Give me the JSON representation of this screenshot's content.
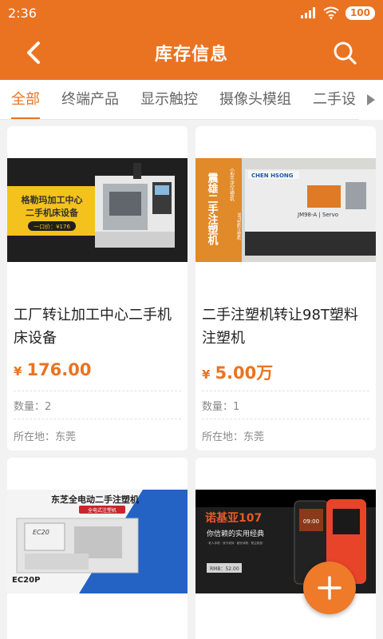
{
  "status": {
    "time": "2:36",
    "battery": "100"
  },
  "header": {
    "title": "库存信息"
  },
  "tabs": [
    "全部",
    "终端产品",
    "显示触控",
    "摄像头模组",
    "二手设"
  ],
  "products": [
    {
      "title": "工厂转让加工中心二手机床设备",
      "price_symbol": "¥",
      "price": "176.00",
      "quantity": "数量：2",
      "location": "所在地：东莞",
      "image_text": {
        "line1": "格勒玛加工中心",
        "line2": "二手机床设备",
        "tag": "一口价：¥176"
      }
    },
    {
      "title": "二手注塑机转让98T塑料注塑机",
      "price_symbol": "¥",
      "price": "5.00万",
      "quantity": "数量：1",
      "location": "所在地：东莞",
      "image_text": {
        "vertical": "震雄二手注塑机",
        "small1": "小型立式注塑机",
        "small2": "98T塑料注塑机",
        "brand": "CHEN HSONG",
        "model": "JM98-A | Servo"
      }
    },
    {
      "image_text": {
        "headline": "东芝全电动二手注塑机",
        "tag": "全电式注塑机",
        "model": "EC20P",
        "screen": "EC20"
      }
    },
    {
      "image_text": {
        "headline": "诺基亚107",
        "sub": "你信赖的实用经典",
        "tiny": "· 老人手机 · 双卡双待 · 超长待机 · 防尘防刮 ·",
        "price": "RMB：52.00",
        "phone_time": "09:00"
      }
    }
  ],
  "colors": {
    "accent": "#ea7322",
    "fab": "#ee7a2a"
  }
}
